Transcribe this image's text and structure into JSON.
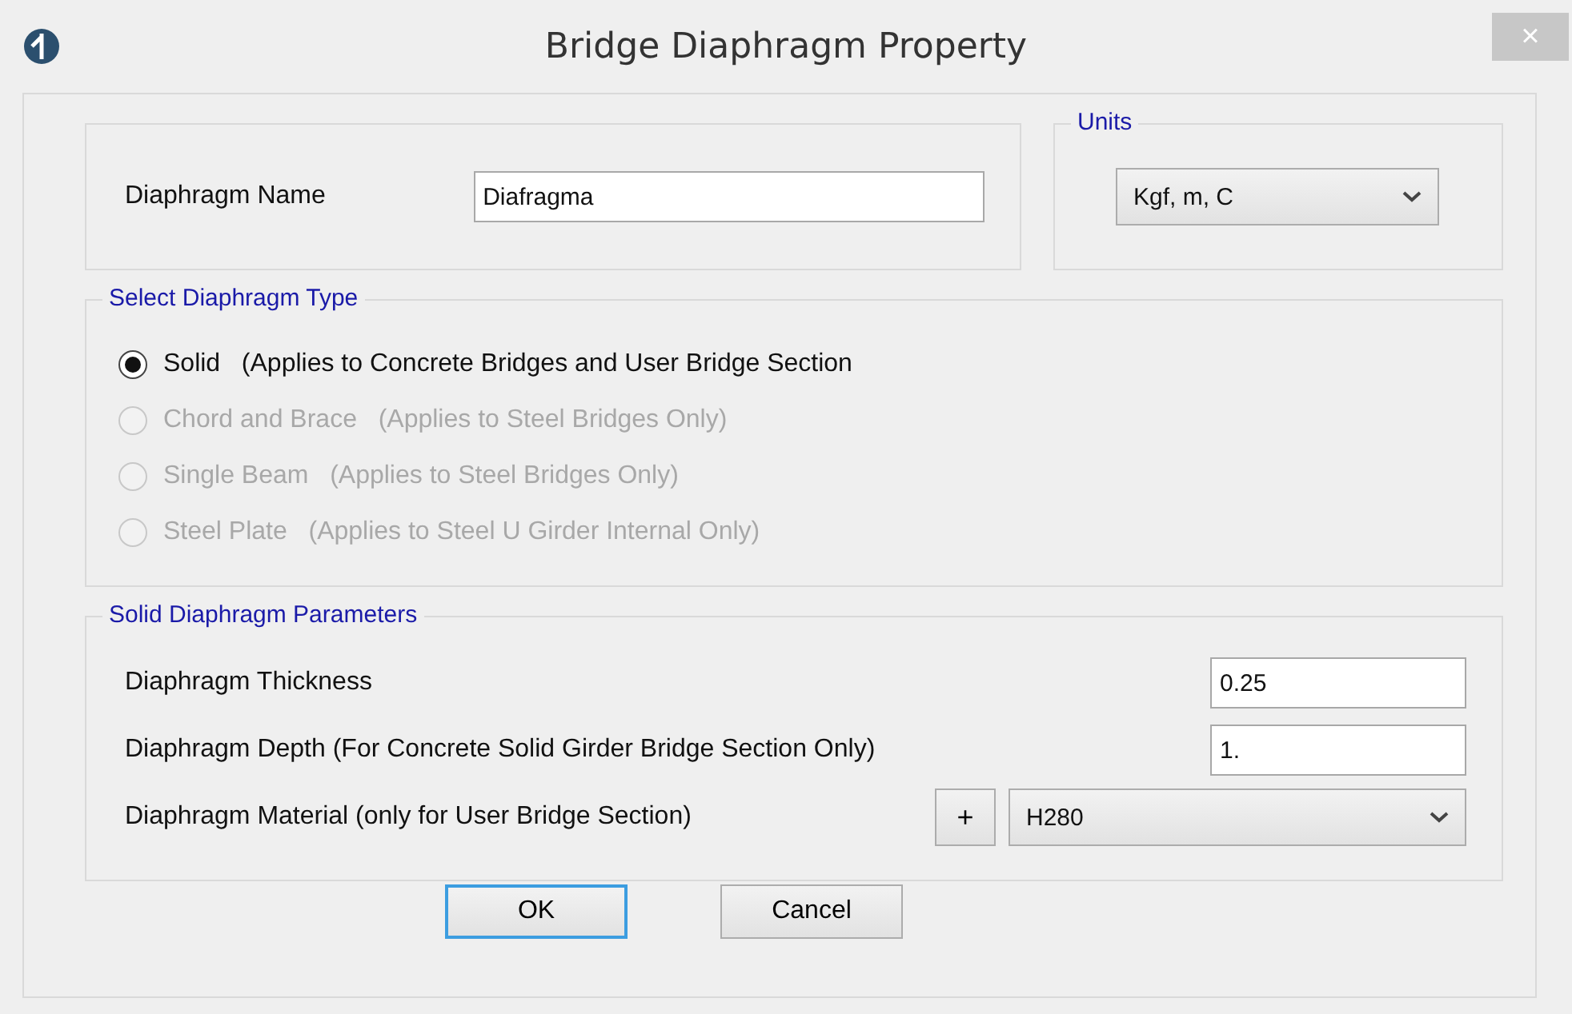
{
  "window": {
    "title": "Bridge Diaphragm Property",
    "close": "×"
  },
  "name_field": {
    "label": "Diaphragm Name",
    "value": "Diafragma"
  },
  "units": {
    "title": "Units",
    "value": "Kgf, m, C"
  },
  "diaphragm_type": {
    "title": "Select Diaphragm Type",
    "options": [
      {
        "label": "Solid",
        "note": "(Applies to Concrete Bridges and User Bridge Section",
        "selected": true,
        "disabled": false
      },
      {
        "label": "Chord and Brace",
        "note": "(Applies to Steel Bridges Only)",
        "selected": false,
        "disabled": true
      },
      {
        "label": "Single Beam",
        "note": "(Applies to Steel Bridges Only)",
        "selected": false,
        "disabled": true
      },
      {
        "label": "Steel Plate",
        "note": "(Applies to Steel U Girder Internal Only)",
        "selected": false,
        "disabled": true
      }
    ]
  },
  "parameters": {
    "title": "Solid Diaphragm Parameters",
    "rows": [
      {
        "kind": "text",
        "label": "Diaphragm Thickness",
        "value": "0.25"
      },
      {
        "kind": "text",
        "label": "Diaphragm Depth (For Concrete Solid Girder Bridge Section Only)",
        "value": "1."
      },
      {
        "kind": "material",
        "label": "Diaphragm Material (only for User Bridge Section)",
        "button": "+",
        "value": "H280"
      }
    ]
  },
  "buttons": [
    "OK",
    "Cancel"
  ]
}
